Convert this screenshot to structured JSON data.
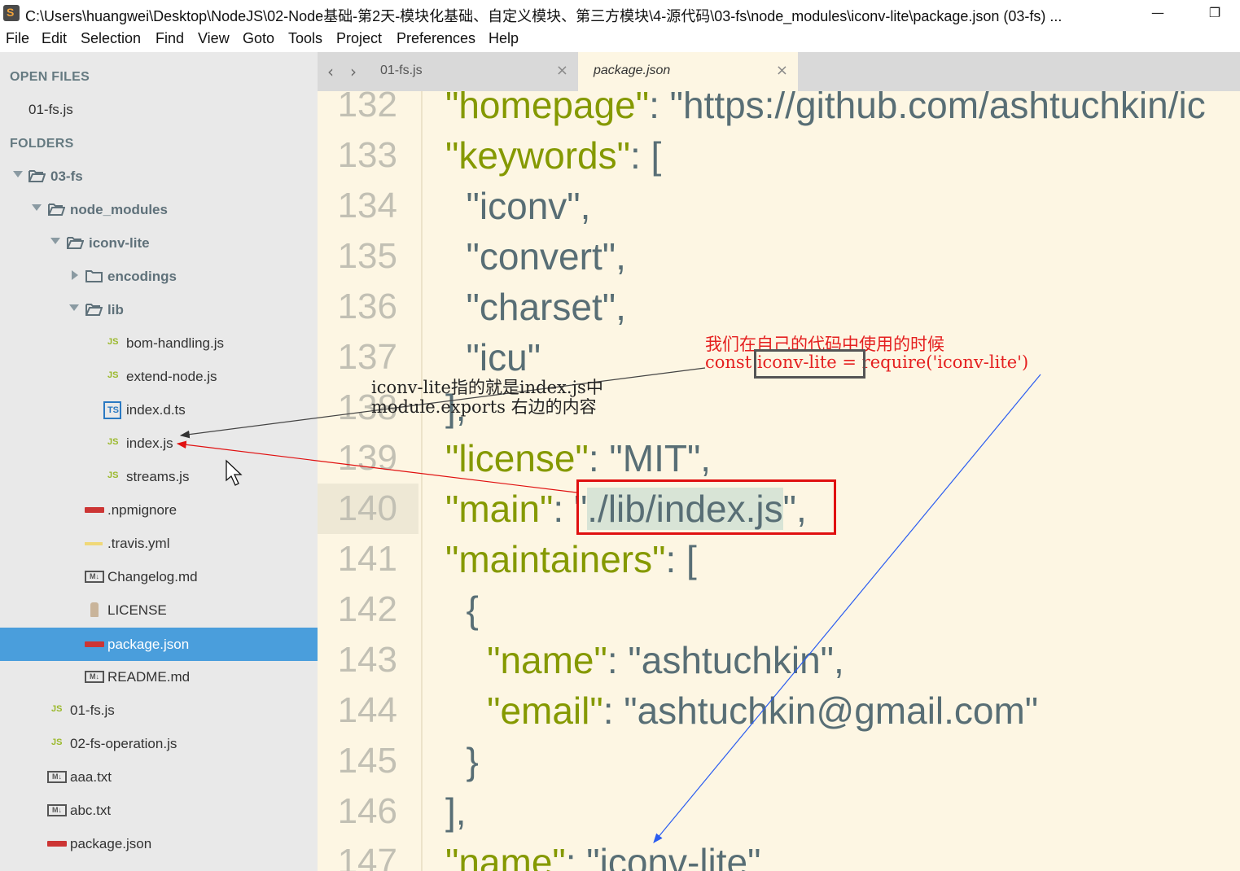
{
  "window": {
    "title": "C:\\Users\\huangwei\\Desktop\\NodeJS\\02-Node基础-第2天-模块化基础、自定义模块、第三方模块\\4-源代码\\03-fs\\node_modules\\iconv-lite\\package.json (03-fs) ...",
    "minimize_glyph": "—",
    "restore_glyph": "❐"
  },
  "menu": [
    "File",
    "Edit",
    "Selection",
    "Find",
    "View",
    "Goto",
    "Tools",
    "Project",
    "Preferences",
    "Help"
  ],
  "sidebar": {
    "open_files_heading": "OPEN FILES",
    "open_files": [
      "01-fs.js"
    ],
    "folders_heading": "FOLDERS",
    "tree": [
      {
        "label": "03-fs",
        "kind": "folder",
        "state": "open"
      },
      {
        "label": "node_modules",
        "kind": "folder",
        "state": "open"
      },
      {
        "label": "iconv-lite",
        "kind": "folder",
        "state": "open"
      },
      {
        "label": "encodings",
        "kind": "folder",
        "state": "closed"
      },
      {
        "label": "lib",
        "kind": "folder",
        "state": "open"
      },
      {
        "label": "bom-handling.js",
        "kind": "js"
      },
      {
        "label": "extend-node.js",
        "kind": "js"
      },
      {
        "label": "index.d.ts",
        "kind": "ts"
      },
      {
        "label": "index.js",
        "kind": "js"
      },
      {
        "label": "streams.js",
        "kind": "js"
      },
      {
        "label": ".npmignore",
        "kind": "npm"
      },
      {
        "label": ".travis.yml",
        "kind": "yml"
      },
      {
        "label": "Changelog.md",
        "kind": "md"
      },
      {
        "label": "LICENSE",
        "kind": "license"
      },
      {
        "label": "package.json",
        "kind": "npm",
        "selected": true
      },
      {
        "label": "README.md",
        "kind": "md"
      },
      {
        "label": "01-fs.js",
        "kind": "js"
      },
      {
        "label": "02-fs-operation.js",
        "kind": "js"
      },
      {
        "label": "aaa.txt",
        "kind": "md"
      },
      {
        "label": "abc.txt",
        "kind": "md"
      },
      {
        "label": "package.json",
        "kind": "npm"
      }
    ],
    "icon_text": {
      "js": "JS",
      "ts": "TS",
      "md": "M↓"
    }
  },
  "tabs": [
    {
      "label": "01-fs.js",
      "active": false
    },
    {
      "label": "package.json",
      "active": true
    }
  ],
  "tab_close_glyph": "×",
  "tab_nav": {
    "back": "‹",
    "forward": "›"
  },
  "editor": {
    "lines": [
      {
        "num": "132",
        "parts": [
          {
            "t": "\"homepage\"",
            "c": "k"
          },
          {
            "t": ": ",
            "c": "p"
          },
          {
            "t": "\"https://github.com/ashtuchkin/ic",
            "c": "s"
          }
        ]
      },
      {
        "num": "133",
        "parts": [
          {
            "t": "\"keywords\"",
            "c": "k"
          },
          {
            "t": ": [",
            "c": "p"
          }
        ]
      },
      {
        "num": "134",
        "parts": [
          {
            "t": "  \"iconv\"",
            "c": "s"
          },
          {
            "t": ",",
            "c": "p"
          }
        ]
      },
      {
        "num": "135",
        "parts": [
          {
            "t": "  \"convert\"",
            "c": "s"
          },
          {
            "t": ",",
            "c": "p"
          }
        ]
      },
      {
        "num": "136",
        "parts": [
          {
            "t": "  \"charset\"",
            "c": "s"
          },
          {
            "t": ",",
            "c": "p"
          }
        ]
      },
      {
        "num": "137",
        "parts": [
          {
            "t": "  \"icu\"",
            "c": "s"
          }
        ]
      },
      {
        "num": "138",
        "parts": [
          {
            "t": "],",
            "c": "p"
          }
        ]
      },
      {
        "num": "139",
        "parts": [
          {
            "t": "\"license\"",
            "c": "k"
          },
          {
            "t": ": ",
            "c": "p"
          },
          {
            "t": "\"MIT\"",
            "c": "s"
          },
          {
            "t": ",",
            "c": "p"
          }
        ]
      },
      {
        "num": "140",
        "parts": [
          {
            "t": "\"main\"",
            "c": "k"
          },
          {
            "t": ": ",
            "c": "p"
          },
          {
            "t": "\"",
            "c": "s"
          },
          {
            "t": "./lib/index.js",
            "c": "s sel"
          },
          {
            "t": "\"",
            "c": "s"
          },
          {
            "t": ",",
            "c": "p"
          }
        ],
        "current": true
      },
      {
        "num": "141",
        "parts": [
          {
            "t": "\"maintainers\"",
            "c": "k"
          },
          {
            "t": ": [",
            "c": "p"
          }
        ]
      },
      {
        "num": "142",
        "parts": [
          {
            "t": "  {",
            "c": "p"
          }
        ]
      },
      {
        "num": "143",
        "parts": [
          {
            "t": "    \"name\"",
            "c": "k"
          },
          {
            "t": ": ",
            "c": "p"
          },
          {
            "t": "\"ashtuchkin\"",
            "c": "s"
          },
          {
            "t": ",",
            "c": "p"
          }
        ]
      },
      {
        "num": "144",
        "parts": [
          {
            "t": "    \"email\"",
            "c": "k"
          },
          {
            "t": ": ",
            "c": "p"
          },
          {
            "t": "\"ashtuchkin@gmail.com\"",
            "c": "s"
          }
        ]
      },
      {
        "num": "145",
        "parts": [
          {
            "t": "  }",
            "c": "p"
          }
        ]
      },
      {
        "num": "146",
        "parts": [
          {
            "t": "],",
            "c": "p"
          }
        ]
      },
      {
        "num": "147",
        "parts": [
          {
            "t": "\"name\"",
            "c": "k"
          },
          {
            "t": ": ",
            "c": "p"
          },
          {
            "t": "\"iconv-lite\"",
            "c": "s"
          },
          {
            "t": ",",
            "c": "p"
          }
        ]
      }
    ]
  },
  "annotations": {
    "red_line1": "我们在自己的代码中使用的时候",
    "red_line2_prefix": "const ",
    "red_line2_boxed": "iconv-lite",
    "red_line2_suffix": " = require('iconv-lite')",
    "black_line1": "iconv-lite指的就是index.js中",
    "black_line2": "module.exports 右边的内容"
  },
  "colors": {
    "sidebar_bg": "#e9e9e9",
    "selection": "#4a9edc",
    "editor_bg": "#fdf6e3",
    "key": "#859900",
    "string": "#586e75",
    "annotation_red": "#e52020",
    "arrow_blue": "#2a5cf0"
  }
}
